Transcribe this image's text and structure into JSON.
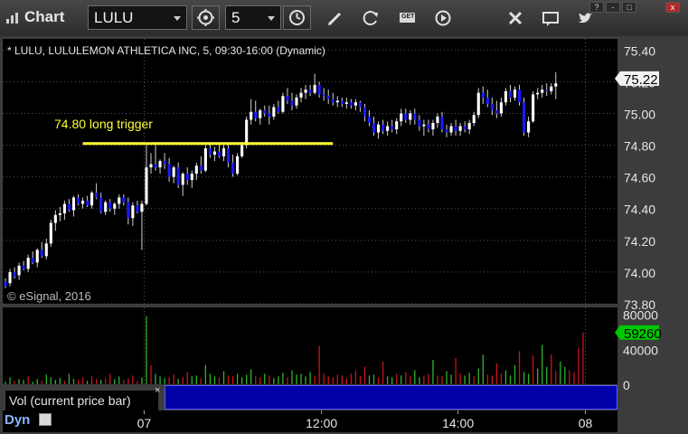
{
  "app": {
    "title": "Chart"
  },
  "toolbar": {
    "symbol": "LULU",
    "interval": "5",
    "buttons": [
      "settings-icon",
      "clock-icon",
      "pencil-icon",
      "refresh-icon",
      "get-icon",
      "play-icon",
      "tools-icon",
      "message-icon",
      "twitter-icon"
    ],
    "get_label": "GET"
  },
  "window_controls": [
    "?",
    "-",
    "□",
    "x"
  ],
  "colors": {
    "up": "#ffffff",
    "down": "#1a1aff",
    "trigger": "#ffff33",
    "grid": "#555555",
    "price_tag_bg": "#f2f2f2",
    "vol_tag_bg": "#00c800",
    "vol_up": "#2db52d",
    "vol_down": "#c8141e"
  },
  "chart_data": {
    "type": "candlestick",
    "title": "* LULU, LULULEMON ATHLETICA INC, 5, 09:30-16:00 (Dynamic)",
    "copyright": "© eSignal, 2016",
    "y_ticks": [
      "75.40",
      "75.20",
      "75.00",
      "74.80",
      "74.60",
      "74.40",
      "74.20",
      "74.00",
      "73.80"
    ],
    "ylim": [
      73.8,
      75.47
    ],
    "last_price": "75.22",
    "x_labels": [
      {
        "label": "07",
        "bar": 31
      },
      {
        "label": "12:00",
        "bar": 70
      },
      {
        "label": "14:00",
        "bar": 100
      },
      {
        "label": "08",
        "bar": 128
      }
    ],
    "session_breaks": [
      31,
      128
    ],
    "annotation": {
      "text": "74.80 long trigger",
      "price": 74.81,
      "from_bar": 17,
      "to_bar": 72
    },
    "candles_ohlc": [
      [
        73.94,
        73.96,
        73.9,
        73.91
      ],
      [
        73.93,
        74.02,
        73.91,
        74.0
      ],
      [
        74.0,
        74.03,
        73.96,
        73.97
      ],
      [
        73.98,
        74.06,
        73.95,
        74.04
      ],
      [
        74.04,
        74.07,
        74.01,
        74.02
      ],
      [
        74.02,
        74.11,
        74.0,
        74.09
      ],
      [
        74.09,
        74.13,
        74.05,
        74.06
      ],
      [
        74.06,
        74.15,
        74.03,
        74.14
      ],
      [
        74.14,
        74.19,
        74.09,
        74.1
      ],
      [
        74.1,
        74.21,
        74.08,
        74.18
      ],
      [
        74.18,
        74.33,
        74.16,
        74.31
      ],
      [
        74.31,
        74.39,
        74.26,
        74.36
      ],
      [
        74.36,
        74.41,
        74.32,
        74.37
      ],
      [
        74.37,
        74.45,
        74.33,
        74.43
      ],
      [
        74.43,
        74.46,
        74.38,
        74.39
      ],
      [
        74.39,
        74.48,
        74.35,
        74.47
      ],
      [
        74.47,
        74.49,
        74.42,
        74.43
      ],
      [
        74.43,
        74.47,
        74.4,
        74.45
      ],
      [
        74.45,
        74.48,
        74.41,
        74.42
      ],
      [
        74.42,
        74.51,
        74.4,
        74.5
      ],
      [
        74.5,
        74.56,
        74.46,
        74.47
      ],
      [
        74.47,
        74.5,
        74.37,
        74.38
      ],
      [
        74.38,
        74.45,
        74.36,
        74.44
      ],
      [
        74.44,
        74.46,
        74.38,
        74.4
      ],
      [
        74.4,
        74.44,
        74.36,
        74.43
      ],
      [
        74.43,
        74.49,
        74.4,
        74.47
      ],
      [
        74.47,
        74.49,
        74.42,
        74.44
      ],
      [
        74.44,
        74.47,
        74.3,
        74.34
      ],
      [
        74.34,
        74.44,
        74.29,
        74.42
      ],
      [
        74.42,
        74.45,
        74.37,
        74.38
      ],
      [
        74.38,
        74.45,
        74.14,
        74.43
      ],
      [
        74.43,
        74.8,
        74.42,
        74.66
      ],
      [
        74.66,
        74.75,
        74.62,
        74.68
      ],
      [
        74.68,
        74.8,
        74.64,
        74.66
      ],
      [
        74.66,
        74.71,
        74.62,
        74.7
      ],
      [
        74.7,
        74.75,
        74.65,
        74.68
      ],
      [
        74.68,
        74.72,
        74.57,
        74.6
      ],
      [
        74.6,
        74.67,
        74.56,
        74.66
      ],
      [
        74.66,
        74.69,
        74.53,
        74.55
      ],
      [
        74.55,
        74.63,
        74.48,
        74.62
      ],
      [
        74.62,
        74.66,
        74.55,
        74.58
      ],
      [
        74.58,
        74.64,
        74.53,
        74.62
      ],
      [
        74.62,
        74.69,
        74.58,
        74.67
      ],
      [
        74.67,
        74.73,
        74.62,
        74.64
      ],
      [
        74.64,
        74.8,
        74.63,
        74.78
      ],
      [
        74.78,
        74.82,
        74.72,
        74.74
      ],
      [
        74.74,
        74.79,
        74.7,
        74.76
      ],
      [
        74.76,
        74.81,
        74.72,
        74.73
      ],
      [
        74.73,
        74.8,
        74.7,
        74.78
      ],
      [
        74.78,
        74.81,
        74.66,
        74.69
      ],
      [
        74.69,
        74.74,
        74.6,
        74.62
      ],
      [
        74.62,
        74.75,
        74.61,
        74.73
      ],
      [
        74.73,
        74.82,
        74.72,
        74.8
      ],
      [
        74.8,
        74.98,
        74.78,
        74.96
      ],
      [
        74.96,
        75.09,
        74.93,
        75.01
      ],
      [
        75.01,
        75.08,
        74.95,
        74.97
      ],
      [
        74.97,
        75.03,
        74.93,
        75.02
      ],
      [
        75.02,
        75.05,
        74.98,
        75.0
      ],
      [
        75.0,
        75.05,
        74.93,
        74.98
      ],
      [
        74.98,
        75.06,
        74.96,
        75.04
      ],
      [
        75.04,
        75.08,
        75.0,
        75.01
      ],
      [
        75.01,
        75.13,
        75.0,
        75.11
      ],
      [
        75.11,
        75.16,
        75.06,
        75.08
      ],
      [
        75.08,
        75.13,
        75.02,
        75.05
      ],
      [
        75.05,
        75.12,
        75.03,
        75.1
      ],
      [
        75.1,
        75.16,
        75.07,
        75.13
      ],
      [
        75.13,
        75.18,
        75.09,
        75.15
      ],
      [
        75.15,
        75.18,
        75.11,
        75.13
      ],
      [
        75.13,
        75.25,
        75.12,
        75.18
      ],
      [
        75.18,
        75.2,
        75.1,
        75.12
      ],
      [
        75.12,
        75.16,
        75.08,
        75.11
      ],
      [
        75.11,
        75.15,
        75.06,
        75.09
      ],
      [
        75.09,
        75.13,
        75.05,
        75.07
      ],
      [
        75.07,
        75.11,
        75.04,
        75.08
      ],
      [
        75.08,
        75.1,
        75.04,
        75.06
      ],
      [
        75.06,
        75.1,
        75.03,
        75.07
      ],
      [
        75.07,
        75.09,
        75.03,
        75.05
      ],
      [
        75.05,
        75.09,
        75.02,
        75.07
      ],
      [
        75.07,
        75.08,
        75.01,
        75.04
      ],
      [
        75.04,
        75.06,
        74.95,
        74.98
      ],
      [
        74.98,
        75.02,
        74.92,
        74.94
      ],
      [
        74.94,
        74.98,
        74.86,
        74.88
      ],
      [
        74.88,
        74.95,
        74.84,
        74.93
      ],
      [
        74.93,
        74.96,
        74.87,
        74.89
      ],
      [
        74.89,
        74.95,
        74.86,
        74.92
      ],
      [
        74.92,
        74.96,
        74.88,
        74.9
      ],
      [
        74.9,
        74.97,
        74.87,
        74.95
      ],
      [
        74.95,
        75.03,
        74.92,
        75.0
      ],
      [
        75.0,
        75.03,
        74.94,
        74.96
      ],
      [
        74.96,
        75.02,
        74.93,
        75.0
      ],
      [
        75.0,
        75.03,
        74.93,
        74.96
      ],
      [
        74.96,
        74.99,
        74.89,
        74.92
      ],
      [
        74.92,
        74.96,
        74.86,
        74.93
      ],
      [
        74.93,
        74.96,
        74.88,
        74.9
      ],
      [
        74.9,
        74.96,
        74.86,
        74.94
      ],
      [
        74.94,
        75.0,
        74.91,
        74.98
      ],
      [
        74.98,
        75.01,
        74.88,
        74.9
      ],
      [
        74.9,
        74.93,
        74.85,
        74.88
      ],
      [
        74.88,
        74.94,
        74.86,
        74.92
      ],
      [
        74.92,
        74.96,
        74.86,
        74.89
      ],
      [
        74.89,
        74.94,
        74.86,
        74.92
      ],
      [
        74.92,
        74.95,
        74.88,
        74.9
      ],
      [
        74.9,
        74.96,
        74.87,
        74.94
      ],
      [
        74.94,
        75.01,
        74.92,
        74.99
      ],
      [
        74.99,
        75.16,
        74.97,
        75.13
      ],
      [
        75.13,
        75.17,
        75.06,
        75.1
      ],
      [
        75.1,
        75.15,
        75.04,
        75.06
      ],
      [
        75.06,
        75.1,
        74.99,
        75.02
      ],
      [
        75.02,
        75.08,
        74.97,
        75.0
      ],
      [
        75.0,
        75.1,
        74.98,
        75.07
      ],
      [
        75.07,
        75.16,
        75.05,
        75.14
      ],
      [
        75.14,
        75.18,
        75.07,
        75.1
      ],
      [
        75.1,
        75.17,
        75.08,
        75.15
      ],
      [
        75.15,
        75.18,
        75.05,
        75.07
      ],
      [
        75.07,
        75.1,
        74.86,
        74.88
      ],
      [
        74.88,
        74.98,
        74.85,
        74.95
      ],
      [
        74.95,
        75.14,
        74.94,
        75.12
      ],
      [
        75.12,
        75.16,
        75.09,
        75.13
      ],
      [
        75.13,
        75.18,
        75.1,
        75.15
      ],
      [
        75.15,
        75.19,
        75.11,
        75.14
      ],
      [
        75.14,
        75.19,
        75.12,
        75.17
      ],
      [
        75.17,
        75.26,
        75.09,
        75.19
      ]
    ],
    "volume": {
      "y_ticks": [
        "80000",
        "40000",
        "0"
      ],
      "ylim": [
        0,
        88000
      ],
      "last": "59260",
      "values": [
        3000,
        8000,
        4000,
        6000,
        5000,
        9000,
        3000,
        6000,
        4000,
        11000,
        8000,
        5000,
        7000,
        4000,
        12000,
        6000,
        5000,
        8000,
        4000,
        9000,
        6000,
        5000,
        7000,
        12000,
        6000,
        9000,
        5000,
        7000,
        10000,
        4000,
        8000,
        78000,
        22000,
        12000,
        9000,
        7000,
        8000,
        11000,
        6000,
        8000,
        14000,
        9000,
        10000,
        7000,
        22000,
        12000,
        9000,
        8000,
        15000,
        10000,
        9000,
        12000,
        8000,
        11000,
        17000,
        9000,
        8000,
        12000,
        10000,
        7000,
        9000,
        13000,
        8000,
        16000,
        11000,
        12000,
        9000,
        14000,
        10000,
        44000,
        12000,
        9000,
        8000,
        11000,
        10000,
        7000,
        12000,
        16000,
        9000,
        20000,
        10000,
        11000,
        8000,
        26000,
        9000,
        8000,
        12000,
        10000,
        14000,
        9000,
        16000,
        8000,
        10000,
        12000,
        28000,
        10000,
        9000,
        15000,
        11000,
        30000,
        12000,
        10000,
        13000,
        9000,
        18000,
        34000,
        11000,
        10000,
        24000,
        12000,
        16000,
        10000,
        22000,
        38000,
        14000,
        12000,
        33000,
        18000,
        45000,
        20000,
        34000,
        15000,
        26000,
        20000,
        16000,
        14000,
        42000,
        59260
      ],
      "directions": "uuduuduuduuuuduudduddudduudddduuduuuddudduuduuududduuuudduduuuduuuuudddddddddddduudduududduuddudduudduuduudddduuuduuduuudduu"
    }
  },
  "volume_label": "Vol (current price bar)",
  "volume_close": "×",
  "footer": {
    "interval_mode": "Dyn"
  }
}
